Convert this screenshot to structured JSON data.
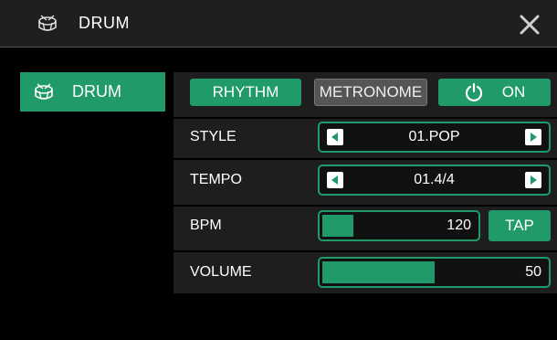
{
  "header": {
    "title": "DRUM",
    "icon": "drum-icon",
    "close_icon": "close-icon"
  },
  "sidebar": {
    "items": [
      {
        "label": "DRUM",
        "icon": "drum-icon",
        "selected": true
      }
    ]
  },
  "tabs": {
    "rhythm_label": "RHYTHM",
    "metronome_label": "METRONOME",
    "power_label": "ON",
    "power_icon": "power-icon"
  },
  "rows": {
    "style": {
      "label": "STYLE",
      "value": "01.POP"
    },
    "tempo": {
      "label": "TEMPO",
      "value": "01.4/4"
    },
    "bpm": {
      "label": "BPM",
      "value": "120",
      "level": 0.2,
      "tap_label": "TAP"
    },
    "volume": {
      "label": "VOLUME",
      "value": "50",
      "level": 0.5
    }
  },
  "colors": {
    "accent": "#1f9a68",
    "panel": "#1e1e1e",
    "header": "#1f1f1f",
    "background": "#000000",
    "inactive_tab": "#555555"
  }
}
